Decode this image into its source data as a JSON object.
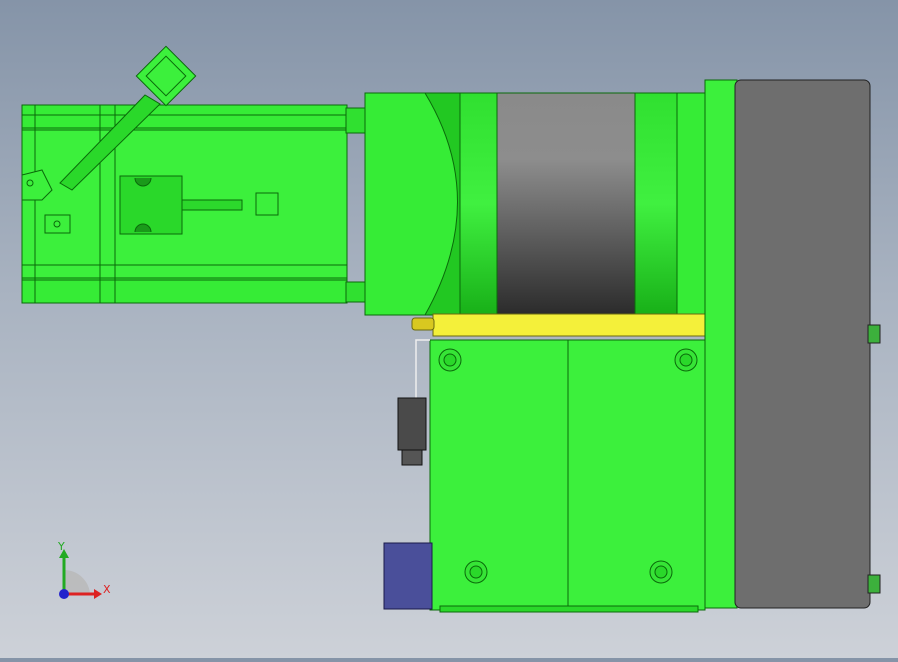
{
  "viewport": {
    "triad": {
      "x_label": "X",
      "y_label": "Y"
    }
  },
  "colors": {
    "part_green": "#2ee82e",
    "part_dark": "#0a7a0a",
    "housing_gray": "#6e6e6e",
    "bracket_yellow": "#f4f03a",
    "connector_blue": "#4a4f9a"
  }
}
